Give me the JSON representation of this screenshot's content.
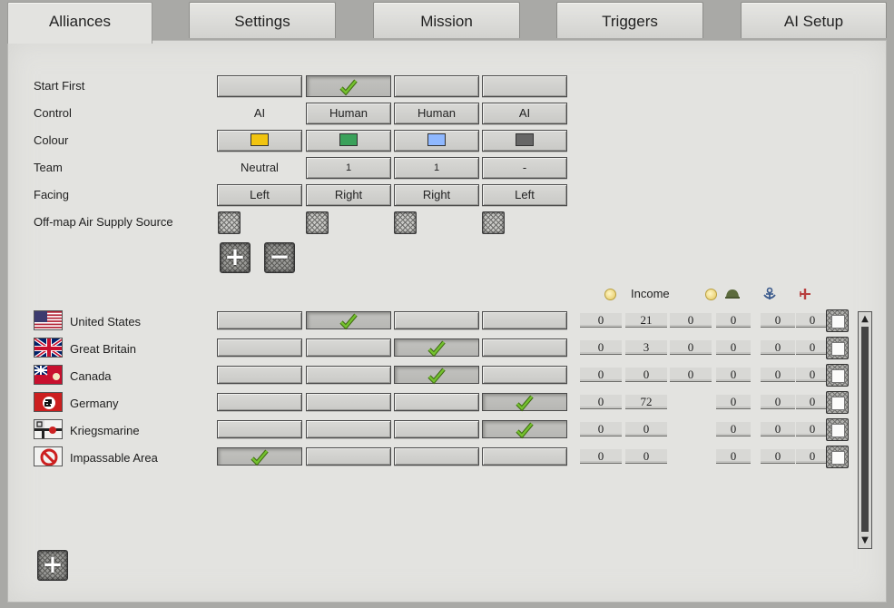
{
  "tabs": [
    "Alliances",
    "Settings",
    "Mission",
    "Triggers",
    "AI Setup"
  ],
  "active_tab": "Alliances",
  "settings": {
    "labels": {
      "start_first": "Start First",
      "control": "Control",
      "colour": "Colour",
      "team": "Team",
      "facing": "Facing",
      "air_supply": "Off-map Air Supply Source"
    },
    "start_first_checked": [
      false,
      true,
      false,
      false
    ],
    "control": [
      "AI",
      "Human",
      "Human",
      "AI"
    ],
    "colours": [
      "#f1c40f",
      "#3aa15a",
      "#8fb8ff",
      "#666666"
    ],
    "team": [
      "Neutral",
      "1",
      "1",
      "-"
    ],
    "facing": [
      "Left",
      "Right",
      "Right",
      "Left"
    ]
  },
  "add_side_symbol": "+",
  "remove_side_symbol": "−",
  "add_nation_symbol": "+",
  "header": {
    "income_label": "Income",
    "icons": [
      "coin-icon",
      "coin-icon",
      "helmet-icon",
      "anchor-icon",
      "plane-icon"
    ]
  },
  "nations": [
    {
      "name": "United States",
      "flag": "us-flag-icon",
      "side": 1,
      "values": [
        "0",
        "21",
        "0",
        "0",
        "0",
        "0"
      ]
    },
    {
      "name": "Great Britain",
      "flag": "uk-flag-icon",
      "side": 2,
      "values": [
        "0",
        "3",
        "0",
        "0",
        "0",
        "0"
      ]
    },
    {
      "name": "Canada",
      "flag": "canada-flag-icon",
      "side": 2,
      "values": [
        "0",
        "0",
        "0",
        "0",
        "0",
        "0"
      ]
    },
    {
      "name": "Germany",
      "flag": "germany-flag-icon",
      "side": 3,
      "values": [
        "0",
        "72",
        "",
        "0",
        "0",
        "0"
      ]
    },
    {
      "name": "Kriegsmarine",
      "flag": "kriegsmarine-flag-icon",
      "side": 3,
      "values": [
        "0",
        "0",
        "",
        "0",
        "0",
        "0"
      ]
    },
    {
      "name": "Impassable Area",
      "flag": "no-entry-icon",
      "side": 0,
      "values": [
        "0",
        "0",
        "",
        "0",
        "0",
        "0"
      ]
    }
  ],
  "colors": {
    "panel": "#e3e3e0",
    "background": "#a9a9a6",
    "check": "#6fb830"
  }
}
